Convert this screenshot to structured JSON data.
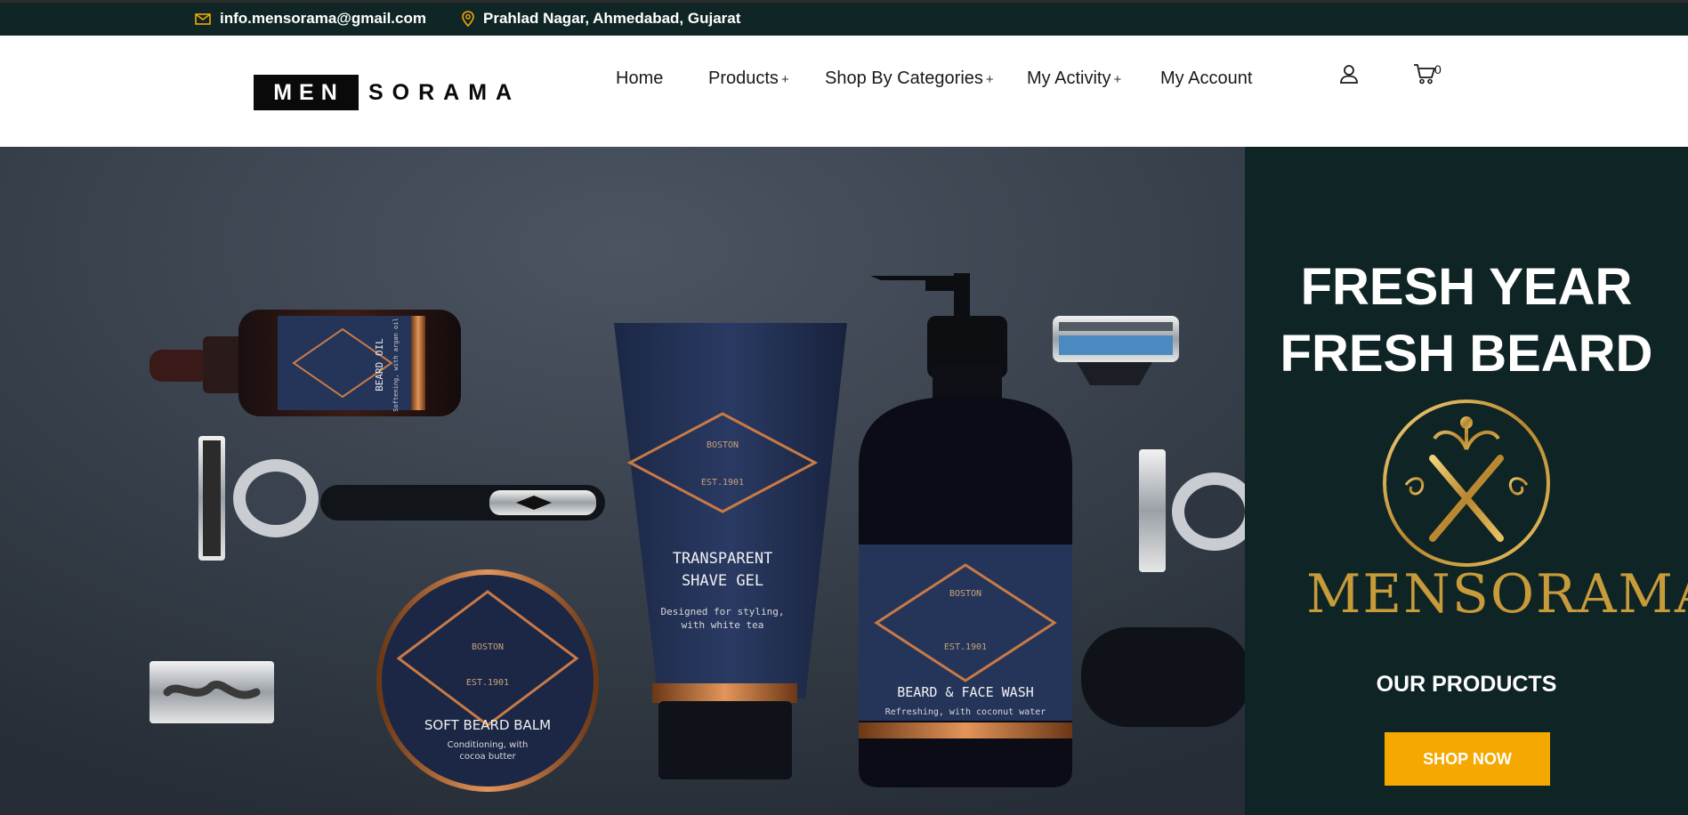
{
  "topbar": {
    "email": "info.mensorama@gmail.com",
    "address": "Prahlad Nagar, Ahmedabad, Gujarat",
    "icons": [
      "mail-icon",
      "location-pin-icon"
    ],
    "accent": "#f5a800",
    "background": "#102626"
  },
  "header": {
    "logo": {
      "box_text": "MEN",
      "rest_text": "SORAMA"
    },
    "nav": [
      {
        "label": "Home",
        "has_submenu": false
      },
      {
        "label": "Products",
        "has_submenu": true
      },
      {
        "label": "Shop By Categories",
        "has_submenu": true
      },
      {
        "label": "My Activity",
        "has_submenu": true
      },
      {
        "label": "My Account",
        "has_submenu": false
      }
    ],
    "submenu_marker": "+",
    "icons": [
      "user-icon",
      "cart-icon"
    ],
    "cart_count": "0"
  },
  "hero": {
    "title_line1": "FRESH YEAR",
    "title_line2": "FRESH BEARD",
    "brand_word": "MENSORAMA",
    "products_label": "OUR PRODUCTS",
    "cta_label": "SHOP NOW",
    "panel_color": "#0f2424",
    "cta_color": "#f5a800",
    "product_labels": {
      "beard_oil": "BEARD OIL",
      "beard_oil_sub": "Softening, with argan oil",
      "gel_line1": "TRANSPARENT",
      "gel_line2": "SHAVE GEL",
      "gel_sub1": "Designed for styling,",
      "gel_sub2": "with white tea",
      "wash": "BEARD & FACE WASH",
      "wash_sub": "Refreshing, with coconut water",
      "balm": "SOFT BEARD BALM",
      "balm_sub1": "Conditioning, with",
      "balm_sub2": "cocoa butter",
      "badge_city": "BOSTON",
      "badge_est": "EST.1901"
    }
  }
}
